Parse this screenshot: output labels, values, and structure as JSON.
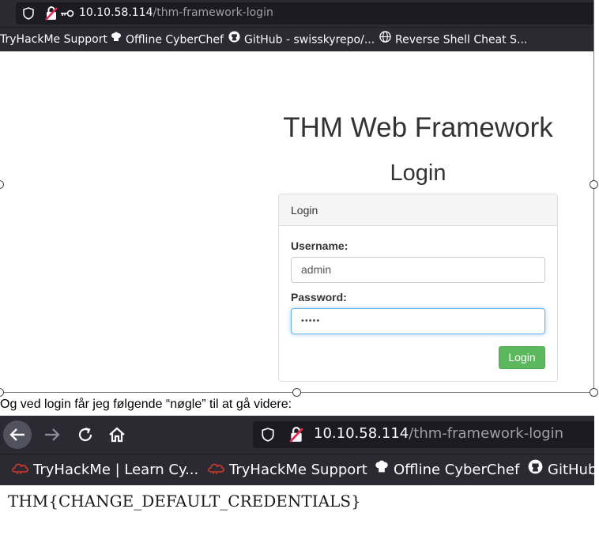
{
  "top_shot": {
    "url_host": "10.10.58.114",
    "url_path": "/thm-framework-login",
    "bookmarks": [
      {
        "label": "TryHackMe Support",
        "icon": "none"
      },
      {
        "label": "Offline CyberChef",
        "icon": "chef-hat-icon"
      },
      {
        "label": "GitHub - swisskyrepo/...",
        "icon": "github-icon"
      },
      {
        "label": "Reverse Shell Cheat S...",
        "icon": "globe-icon"
      }
    ],
    "page_title": "THM Web Framework",
    "login_heading": "Login",
    "panel": {
      "header": "Login",
      "username_label": "Username:",
      "username_value": "admin",
      "password_label": "Password:",
      "password_value": "•••••",
      "submit_label": "Login"
    }
  },
  "caption": "Og ved login får jeg følgende “nøgle” til at gå videre:",
  "bottom_shot": {
    "url_host": "10.10.58.114",
    "url_path": "/thm-framework-login",
    "bookmarks": [
      {
        "label": "TryHackMe | Learn Cy...",
        "icon": "tryhackme-cloud-icon"
      },
      {
        "label": "TryHackMe Support",
        "icon": "tryhackme-cloud-icon"
      },
      {
        "label": "Offline CyberChef",
        "icon": "chef-hat-icon"
      },
      {
        "label": "GitHub",
        "icon": "github-icon"
      }
    ],
    "page_text": "THM{CHANGE_DEFAULT_CREDENTIALS}"
  },
  "colors": {
    "browser_chrome": "#2b2a33",
    "url_field": "#1c1b22",
    "login_button": "#5cb85c",
    "focus_ring": "#66afe9",
    "thm_cloud": "#c4382d"
  }
}
